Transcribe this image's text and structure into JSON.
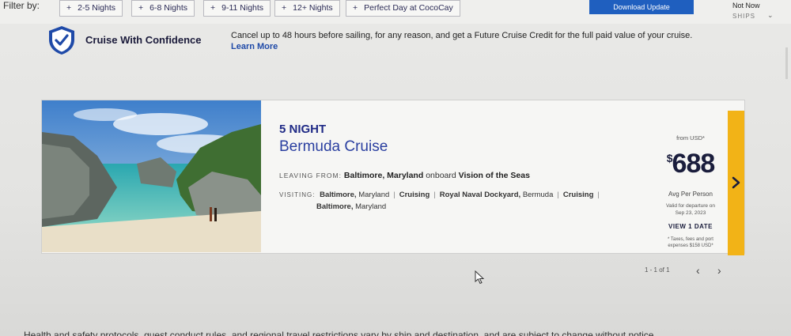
{
  "filter": {
    "label": "Filter by:",
    "chips": [
      {
        "label": "2-5 Nights"
      },
      {
        "label": "6-8 Nights"
      },
      {
        "label": "9-11 Nights"
      },
      {
        "label": "12+ Nights"
      },
      {
        "label": "Perfect Day at CocoCay"
      }
    ]
  },
  "update_banner": {
    "download_label": "Download Update",
    "not_now_label": "Not Now"
  },
  "sort": {
    "label": "SHIPS"
  },
  "confidence": {
    "title": "Cruise With Confidence",
    "text": "Cancel up to 48 hours before sailing, for any reason, and get a Future Cruise Credit for the full paid value of your cruise.",
    "link": "Learn More"
  },
  "card": {
    "night": "5 NIGHT",
    "name": "Bermuda Cruise",
    "leaving_label": "LEAVING FROM:",
    "leaving_port": "Baltimore, Maryland",
    "onboard_text": "onboard",
    "ship": "Vision of the Seas",
    "visiting_label": "VISITING:",
    "ports": [
      {
        "name": "Baltimore,",
        "rest": "Maryland"
      },
      {
        "name": "Cruising",
        "rest": ""
      },
      {
        "name": "Royal Naval Dockyard,",
        "rest": "Bermuda"
      },
      {
        "name": "Cruising",
        "rest": ""
      },
      {
        "name": "Baltimore,",
        "rest": "Maryland"
      }
    ],
    "from_label": "from USD*",
    "currency_symbol": "$",
    "price": "688",
    "per_person": "Avg Per Person",
    "valid_line1": "Valid for departure on",
    "valid_line2": "Sep 23, 2023",
    "view_dates": "VIEW 1 DATE",
    "taxes_line1": "* Taxes, fees and port",
    "taxes_line2": "expenses $158 USD*"
  },
  "pagination": {
    "text": "1 - 1 of 1"
  },
  "footer": {
    "text": "Health and safety protocols, guest conduct rules, and regional travel restrictions vary by ship and destination, and are subject to change without notice."
  },
  "colors": {
    "accent": "#f2b317",
    "brand_blue": "#1f4aa8",
    "download": "#1f5fbf"
  }
}
